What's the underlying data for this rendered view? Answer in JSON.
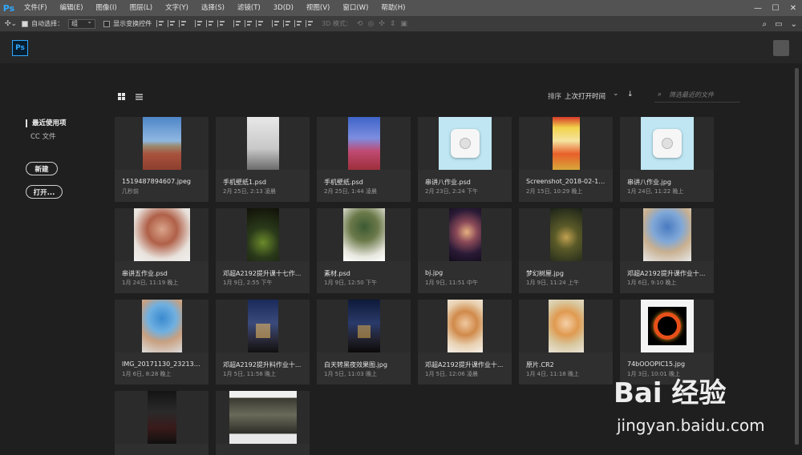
{
  "app": {
    "short_logo": "Ps"
  },
  "menubar": {
    "items": [
      "文件(F)",
      "编辑(E)",
      "图像(I)",
      "图层(L)",
      "文字(Y)",
      "选择(S)",
      "滤镜(T)",
      "3D(D)",
      "视图(V)",
      "窗口(W)",
      "帮助(H)"
    ]
  },
  "window_controls": {
    "minimize": "—",
    "maximize": "☐",
    "close": "✕"
  },
  "optionsbar": {
    "auto_select_label": "自动选择：",
    "auto_select_value": "组",
    "show_transform_label": "显示变换控件",
    "mode_3d_label": "3D 模式："
  },
  "nav": {
    "recent": "最近使用项",
    "cc_files": "CC 文件",
    "new_button": "新建",
    "open_button": "打开..."
  },
  "sort": {
    "label": "排序",
    "value": "上次打开时间"
  },
  "search": {
    "placeholder": "筛选最近的文件"
  },
  "files": [
    {
      "name": "1519487894607.jpeg",
      "date": "几秒前"
    },
    {
      "name": "手机壁纸1.psd",
      "date": "2月 25日, 2:13 凌晨"
    },
    {
      "name": "手机壁纸.psd",
      "date": "2月 25日, 1:44 凌晨"
    },
    {
      "name": "串讲八作业.psd",
      "date": "2月 23日, 2:24 下午"
    },
    {
      "name": "Screenshot_2018-02-15-22...",
      "date": "2月 15日, 10:29 晚上"
    },
    {
      "name": "串讲八作业.jpg",
      "date": "1月 24日, 11:22 晚上"
    },
    {
      "name": "串讲五作业.psd",
      "date": "1月 24日, 11:19 晚上"
    },
    {
      "name": "邓超A2192提升课十七作...",
      "date": "1月 9日, 2:55 下午"
    },
    {
      "name": "素材.psd",
      "date": "1月 9日, 12:50 下午"
    },
    {
      "name": "bj.jpg",
      "date": "1月 9日, 11:51 中午"
    },
    {
      "name": "梦幻树屋.jpg",
      "date": "1月 9日, 11:24 上午"
    },
    {
      "name": "邓超A2192提升课作业十...",
      "date": "1月 6日, 9:10 晚上"
    },
    {
      "name": "IMG_20171130_232131.jpg",
      "date": "1月 6日, 8:28 晚上"
    },
    {
      "name": "邓超A2192提升料作业十...",
      "date": "1月 5日, 11:58 晚上"
    },
    {
      "name": "白天转黑夜效果图.jpg",
      "date": "1月 5日, 11:03 晚上"
    },
    {
      "name": "邓超A2192提升课作业十...",
      "date": "1月 5日, 12:06 凌晨"
    },
    {
      "name": "原片.CR2",
      "date": "1月 4日, 11:18 晚上"
    },
    {
      "name": "74bOOOPIC15.jpg",
      "date": "1月 3日, 10:01 晚上"
    },
    {
      "name": "",
      "date": ""
    },
    {
      "name": "",
      "date": ""
    }
  ],
  "watermark": {
    "logo": "Bai 经验",
    "url": "jingyan.baidu.com"
  },
  "colors": {
    "accent": "#31a8ff",
    "panel": "#2f2f2f",
    "background": "#1f1f1f"
  }
}
